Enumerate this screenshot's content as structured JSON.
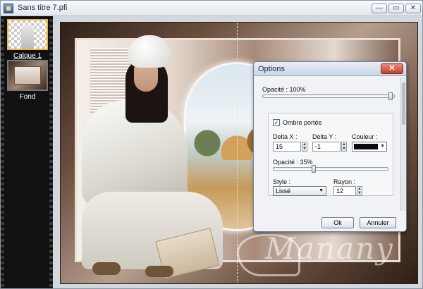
{
  "window": {
    "title": "Sans titre 7.pfi",
    "minimize_glyph": "—",
    "restore_glyph": "▭",
    "close_glyph": "✕"
  },
  "layers": [
    {
      "name": "Calque 1",
      "active": true,
      "icon": "transparent-layer-thumbnail"
    },
    {
      "name": "Fond",
      "active": false,
      "icon": "background-layer-thumbnail"
    }
  ],
  "canvas": {
    "watermark": "Manany"
  },
  "dialog": {
    "title": "Options",
    "close_glyph": "✕",
    "opacity_label": "Opacité : 100%",
    "opacity_value": 100,
    "shadow_checkbox_label": "Ombre portée",
    "shadow_checked": true,
    "check_glyph": "✓",
    "delta_x_label": "Delta X :",
    "delta_x_value": "15",
    "delta_y_label": "Delta Y :",
    "delta_y_value": "-1",
    "color_label": "Couleur :",
    "shadow_color": "#0a0a0a",
    "shadow_opacity_label": "Opacité : 35%",
    "shadow_opacity_value": 35,
    "style_label": "Style :",
    "style_value": "Lissé",
    "radius_label": "Rayon :",
    "radius_value": "12",
    "ok_label": "Ok",
    "cancel_label": "Annuler",
    "spin_up": "▲",
    "spin_down": "▼",
    "dropdown_arrow": "▼"
  },
  "colors": {
    "active_layer_border": "#f2b23a",
    "dialog_close": "#c4402e"
  }
}
